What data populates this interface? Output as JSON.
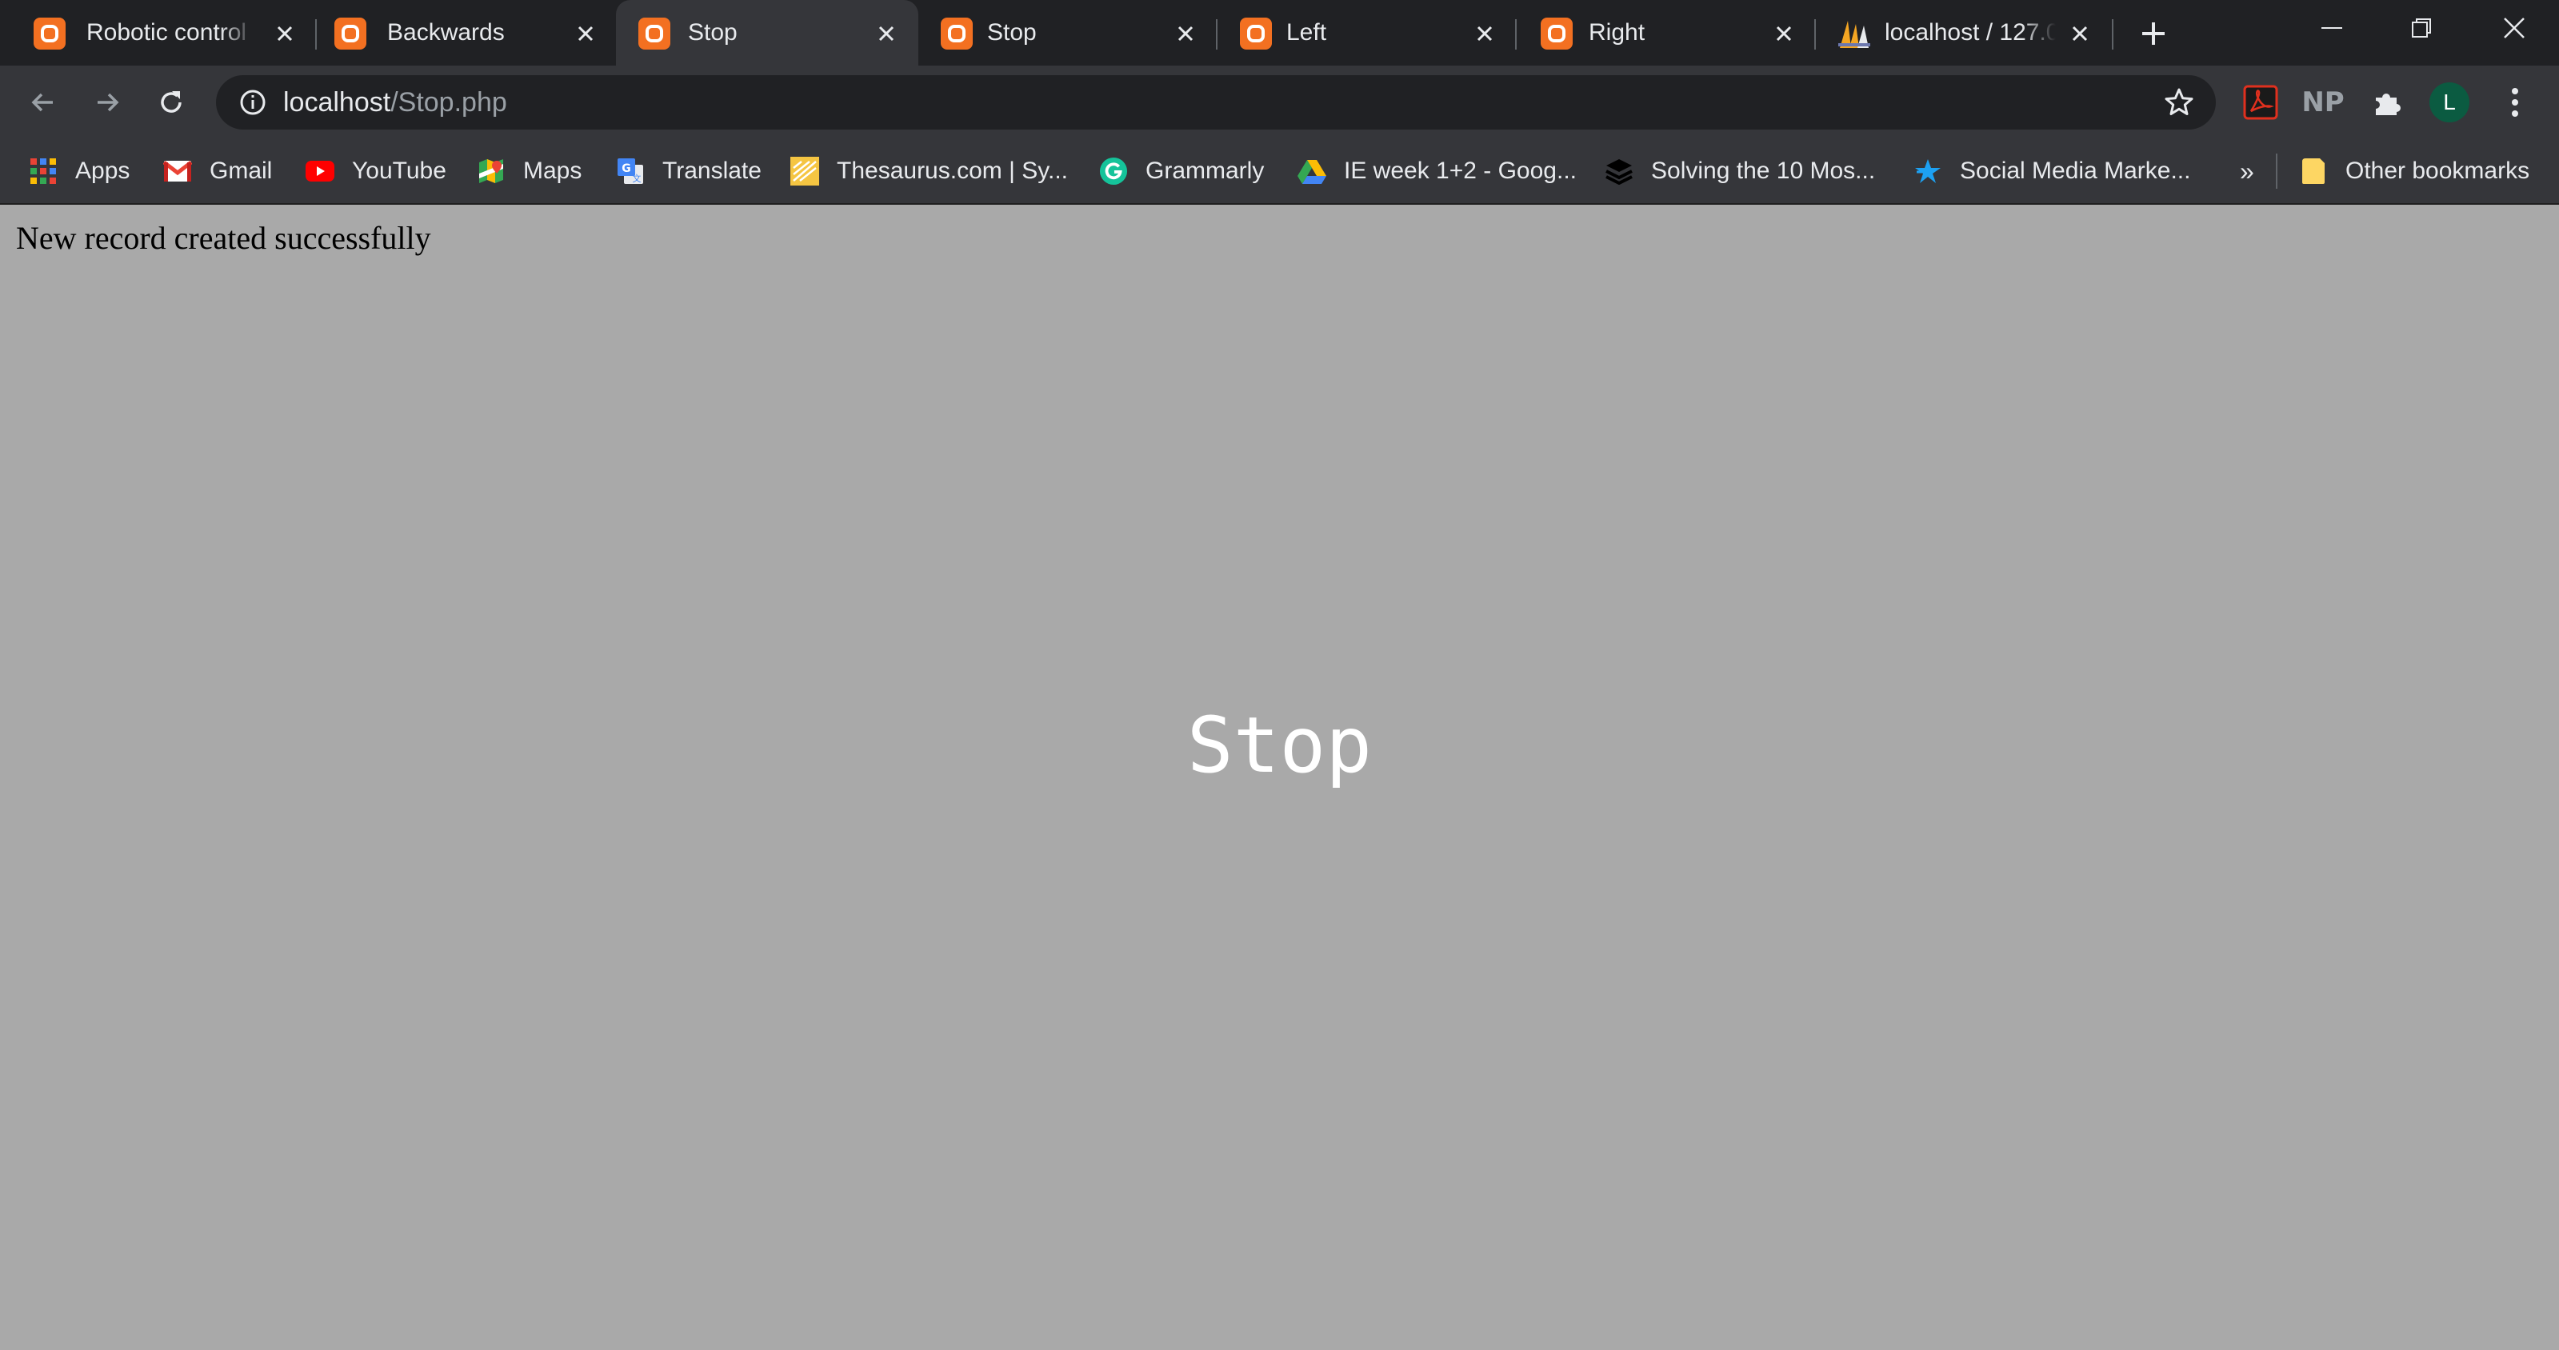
{
  "tabs": [
    {
      "title": "Robotic control ",
      "active": false,
      "icon": "xampp-icon"
    },
    {
      "title": "Backwards",
      "active": false,
      "icon": "xampp-icon"
    },
    {
      "title": "Stop",
      "active": true,
      "icon": "xampp-icon"
    },
    {
      "title": "Stop",
      "active": false,
      "icon": "xampp-icon"
    },
    {
      "title": "Left",
      "active": false,
      "icon": "xampp-icon"
    },
    {
      "title": "Right",
      "active": false,
      "icon": "xampp-icon"
    },
    {
      "title": "localhost / 127.0",
      "active": false,
      "icon": "phpmyadmin-icon"
    }
  ],
  "address_bar": {
    "host": "localhost",
    "path": "/Stop.php"
  },
  "profile": {
    "initial": "L"
  },
  "extensions": {
    "np_label": "NP"
  },
  "bookmarks": {
    "items": [
      {
        "label": "Apps",
        "icon": "apps-grid-icon"
      },
      {
        "label": "Gmail",
        "icon": "gmail-icon"
      },
      {
        "label": "YouTube",
        "icon": "youtube-icon"
      },
      {
        "label": "Maps",
        "icon": "maps-icon"
      },
      {
        "label": "Translate",
        "icon": "translate-icon"
      },
      {
        "label": "Thesaurus.com | Sy...",
        "icon": "thesaurus-icon"
      },
      {
        "label": "Grammarly",
        "icon": "grammarly-icon"
      },
      {
        "label": "IE week 1+2 - Goog...",
        "icon": "google-drive-icon"
      },
      {
        "label": "Solving the 10 Mos...",
        "icon": "buffer-icon"
      },
      {
        "label": "Social Media Marke...",
        "icon": "star-bookmark-icon"
      }
    ],
    "overflow": "»",
    "other": "Other bookmarks"
  },
  "page": {
    "message": "New record created successfully",
    "label": "Stop"
  },
  "colors": {
    "page_background": "#a9a9a9",
    "tabstrip": "#202124",
    "toolbar": "#35363a",
    "xampp": "#f37021"
  }
}
